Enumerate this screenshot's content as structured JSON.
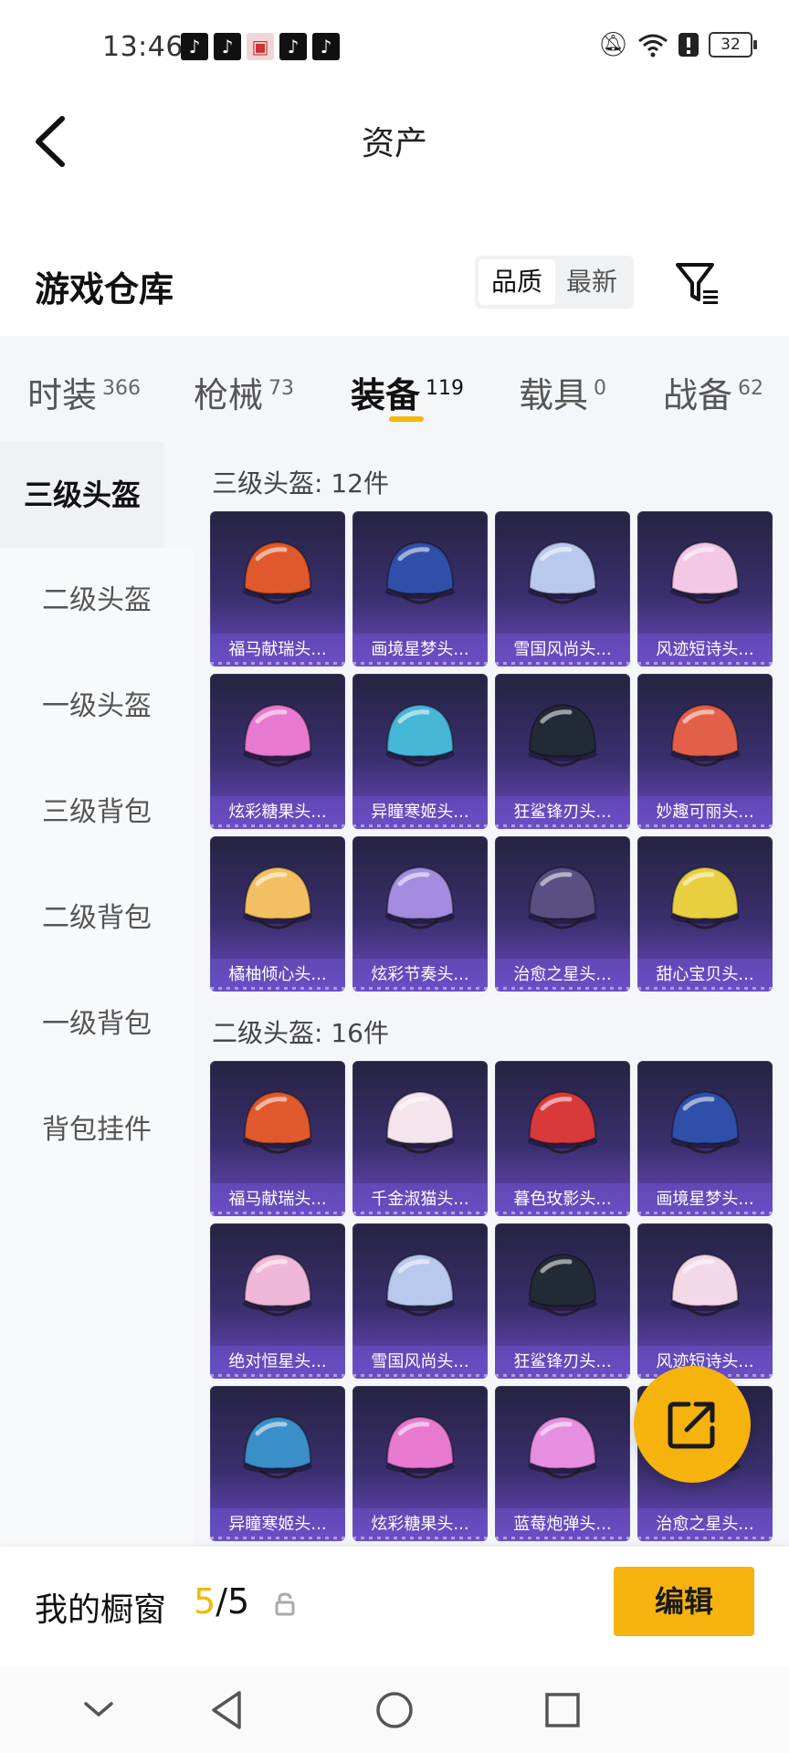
{
  "status_bar": {
    "time": "13:46",
    "notification_icons": [
      "tiktok-icon",
      "tiktok-icon",
      "gift-icon",
      "tiktok-icon",
      "tiktok-icon"
    ],
    "battery": "32"
  },
  "header": {
    "title": "资产"
  },
  "section": {
    "title": "游戏仓库",
    "sort_options": [
      "品质",
      "最新"
    ]
  },
  "tabs": [
    {
      "label": "时装",
      "count": "366"
    },
    {
      "label": "枪械",
      "count": "73"
    },
    {
      "label": "装备",
      "count": "119",
      "active": true
    },
    {
      "label": "载具",
      "count": "0"
    },
    {
      "label": "战备",
      "count": "62"
    }
  ],
  "sidebar": {
    "items": [
      {
        "label": "三级头盔",
        "active": true
      },
      {
        "label": "二级头盔"
      },
      {
        "label": "一级头盔"
      },
      {
        "label": "三级背包"
      },
      {
        "label": "二级背包"
      },
      {
        "label": "一级背包"
      },
      {
        "label": "背包挂件"
      }
    ]
  },
  "groups": [
    {
      "label": "三级头盔: 12件",
      "items": [
        {
          "name": "福马献瑞头...",
          "color": "#e0592c"
        },
        {
          "name": "画境星梦头...",
          "color": "#2f4fa8"
        },
        {
          "name": "雪国风尚头...",
          "color": "#b9c9ee"
        },
        {
          "name": "风迹短诗头...",
          "color": "#f2c8e4"
        },
        {
          "name": "炫彩糖果头...",
          "color": "#e77ad0"
        },
        {
          "name": "异瞳寒姬头...",
          "color": "#46b6d6"
        },
        {
          "name": "狂鲨锋刃头...",
          "color": "#222a36"
        },
        {
          "name": "妙趣可丽头...",
          "color": "#e2604a"
        },
        {
          "name": "橘柚倾心头...",
          "color": "#f2c062"
        },
        {
          "name": "炫彩节奏头...",
          "color": "#a48de0"
        },
        {
          "name": "治愈之星头...",
          "color": "#5a4f82"
        },
        {
          "name": "甜心宝贝头...",
          "color": "#e9cf40"
        }
      ]
    },
    {
      "label": "二级头盔: 16件",
      "items": [
        {
          "name": "福马献瑞头...",
          "color": "#e0592c"
        },
        {
          "name": "千金淑猫头...",
          "color": "#f6e4ec"
        },
        {
          "name": "暮色玫影头...",
          "color": "#d83a3a"
        },
        {
          "name": "画境星梦头...",
          "color": "#2f4fa8"
        },
        {
          "name": "绝对恒星头...",
          "color": "#f0b8d8"
        },
        {
          "name": "雪国风尚头...",
          "color": "#b9c9ee"
        },
        {
          "name": "狂鲨锋刃头...",
          "color": "#222a36"
        },
        {
          "name": "风迹短诗头...",
          "color": "#f3d9e7"
        },
        {
          "name": "异瞳寒姬头...",
          "color": "#3a8fc8"
        },
        {
          "name": "炫彩糖果头...",
          "color": "#e77ad0"
        },
        {
          "name": "蓝莓炮弹头...",
          "color": "#e68fe0"
        },
        {
          "name": "治愈之星头...",
          "color": "#5a4f82"
        }
      ]
    }
  ],
  "bottom_bar": {
    "label": "我的橱窗",
    "count_current": "5",
    "count_total": "/5",
    "edit_label": "编辑"
  },
  "colors": {
    "accent": "#f6b30d",
    "card_gradient_top": "#262342",
    "card_gradient_bottom": "#6a4cc4"
  }
}
